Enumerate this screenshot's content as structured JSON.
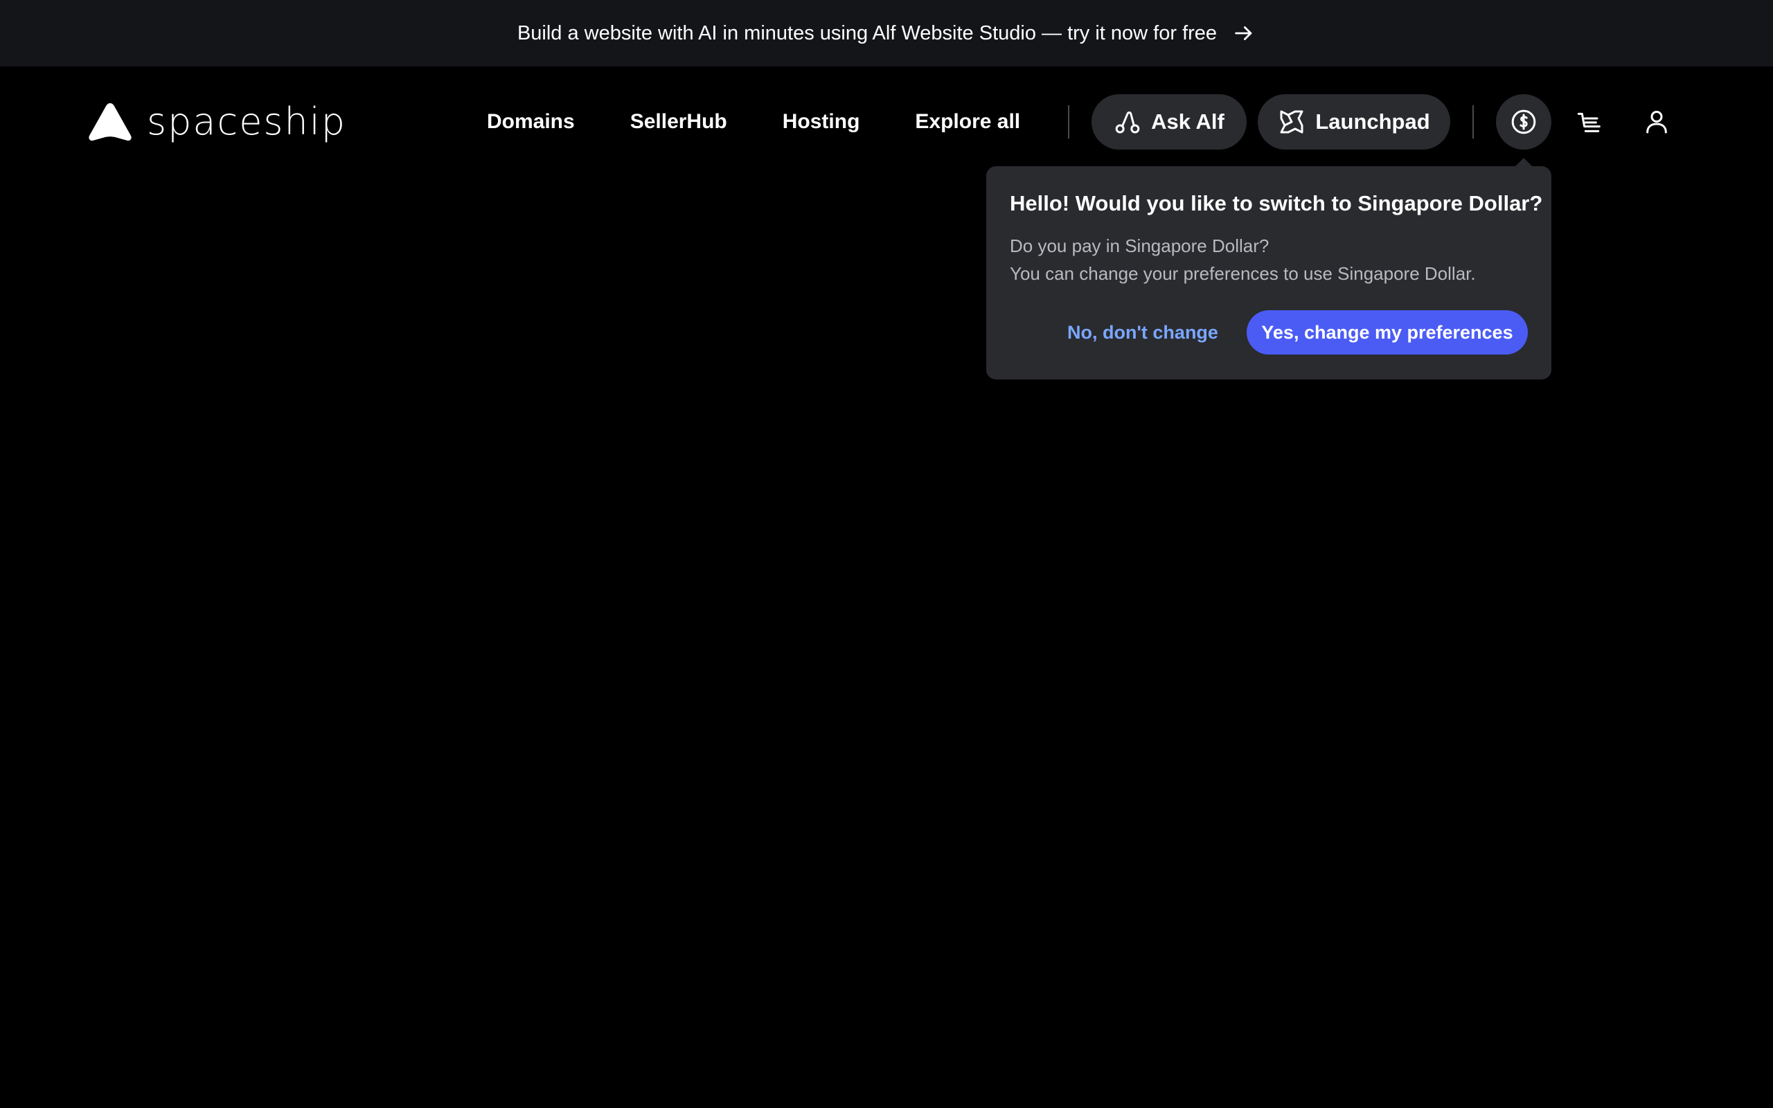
{
  "promo": {
    "text": "Build a website with AI in minutes using Alf Website Studio — try it now for free",
    "arrow_icon": "arrow-right-icon"
  },
  "header": {
    "logo_text": "spaceship",
    "nav": [
      {
        "label": "Domains"
      },
      {
        "label": "SellerHub"
      },
      {
        "label": "Hosting"
      },
      {
        "label": "Explore all"
      }
    ],
    "ask_alf_label": "Ask Alf",
    "launchpad_label": "Launchpad",
    "icons": [
      "currency-globe-icon",
      "cart-icon",
      "user-icon"
    ]
  },
  "currency_popover": {
    "title": "Hello! Would you like to switch to Singapore Dollar?",
    "line1": "Do you pay in Singapore Dollar?",
    "line2": "You can change your preferences to use Singapore Dollar.",
    "decline_label": "No, don't change",
    "accept_label": "Yes, change my preferences"
  },
  "colors": {
    "background": "#000000",
    "promo_bg": "#141518",
    "pill_bg": "#2a2b2f",
    "accent": "#4b5cf5",
    "link": "#7aa7ff"
  }
}
